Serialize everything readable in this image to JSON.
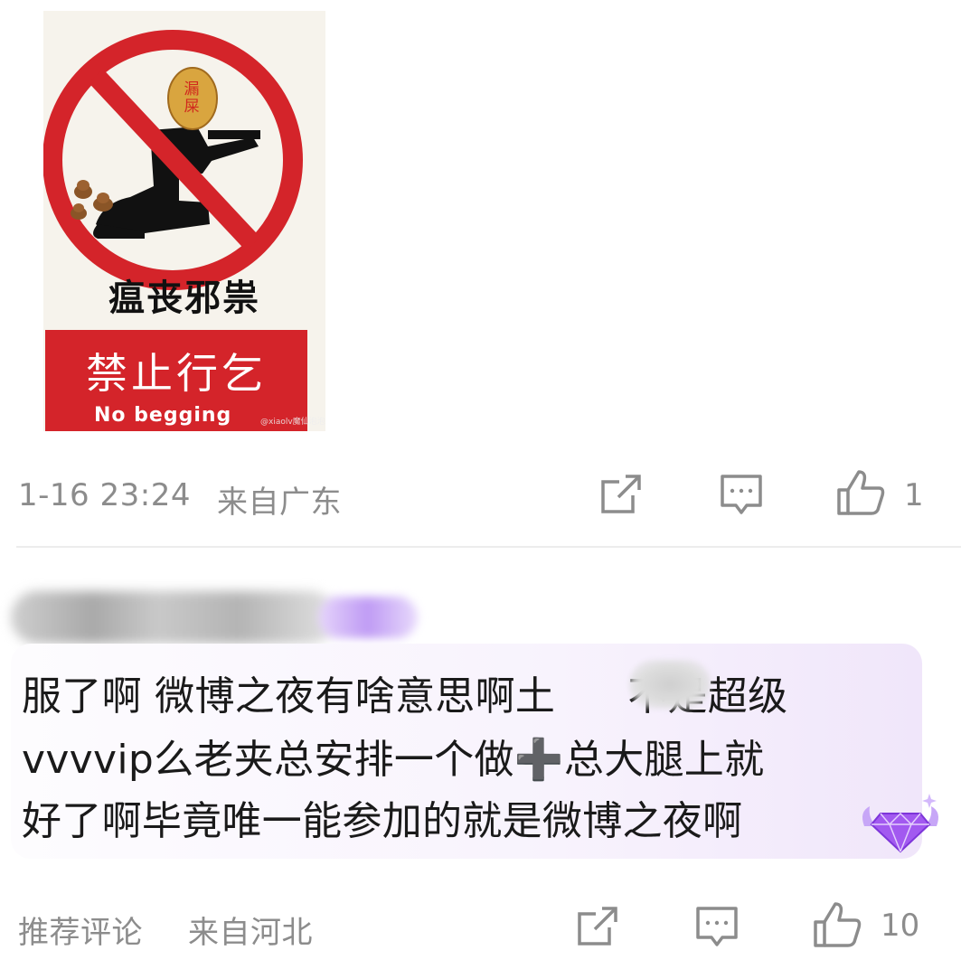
{
  "post_image": {
    "sign_top_text": "瘟丧邪祟",
    "potato_text": "漏屎",
    "sign_cn": "禁止行乞",
    "sign_en": "No begging",
    "watermark": "@xiaolv魔仙泡泡",
    "colors": {
      "red": "#d4242a",
      "background": "#f6f3ec"
    }
  },
  "post_meta": {
    "timestamp": "1-16 23:24",
    "location": "来自广东",
    "like_count": "1",
    "icons": [
      "share-icon",
      "comment-icon",
      "like-icon"
    ]
  },
  "comment": {
    "username": "",
    "text_lines": [
      "服了啊 微博之夜有啥意思啊土",
      "不是超级",
      "vvvvip么老夹总安排一个做",
      "总大腿上就",
      "好了啊毕竟唯一能参加的就是微博之夜啊"
    ],
    "plus_symbol": "➕",
    "label": "推荐评论",
    "location": "来自河北",
    "like_count": "10",
    "icons": [
      "share-icon",
      "comment-icon",
      "like-icon",
      "diamond-badge-icon"
    ]
  }
}
